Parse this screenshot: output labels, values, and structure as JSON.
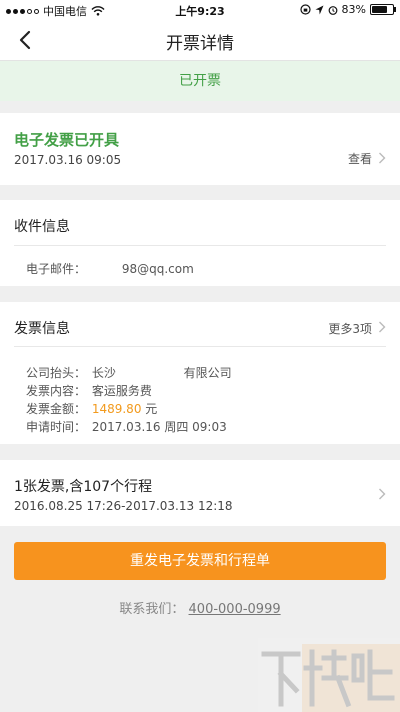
{
  "status_bar": {
    "carrier": "中国电信",
    "time": "上午9:23",
    "battery": "83%",
    "battery_level": 0.83
  },
  "nav": {
    "title": "开票详情"
  },
  "banner": {
    "text": "已开票"
  },
  "e_invoice": {
    "title": "电子发票已开具",
    "datetime": "2017.03.16 09:05",
    "view_label": "查看"
  },
  "recipient": {
    "title": "收件信息",
    "email_label": "电子邮件：",
    "email_value": "98@qq.com"
  },
  "invoice_info": {
    "title": "发票信息",
    "more_label": "更多3项",
    "rows": [
      {
        "label": "公司抬头：",
        "value": "长沙",
        "value2": "有限公司"
      },
      {
        "label": "发票内容：",
        "value": "客运服务费"
      },
      {
        "label": "发票金额：",
        "amount": "1489.80",
        "unit": "元"
      },
      {
        "label": "申请时间：",
        "value": "2017.03.16 周四 09:03"
      }
    ]
  },
  "trips": {
    "summary": "1张发票,含107个行程",
    "range": "2016.08.25 17:26-2017.03.13 12:18"
  },
  "actions": {
    "resend_label": "重发电子发票和行程单"
  },
  "contact": {
    "label": "联系我们：",
    "phone": "400-000-0999"
  },
  "colors": {
    "green": "#43a047",
    "orange": "#f7931e",
    "amount": "#f29a1d"
  }
}
